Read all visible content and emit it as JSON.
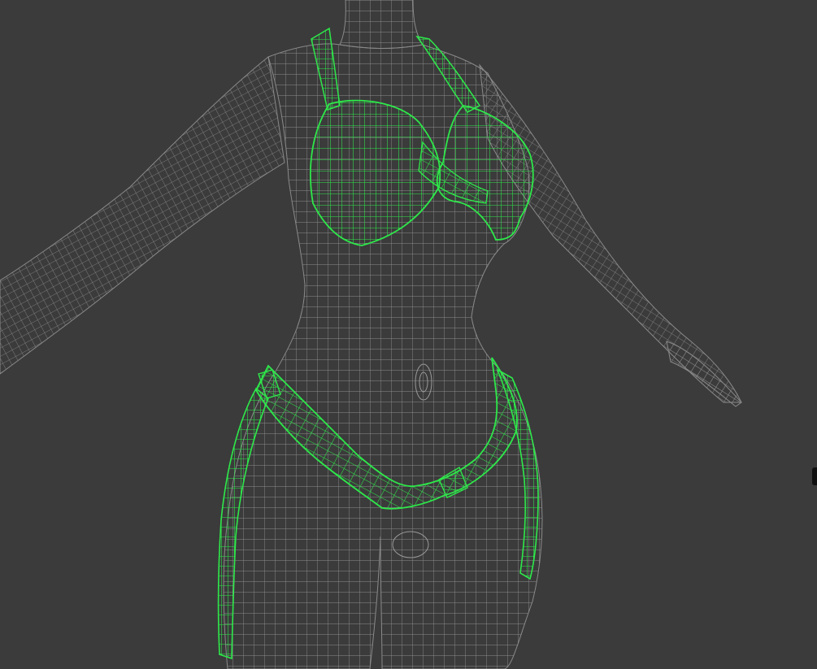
{
  "viewport": {
    "background_color": "#3b3b3b",
    "mesh_color": "#8a8a8a",
    "selection_color": "#2ee84a",
    "mode": "wireframe"
  },
  "scene": {
    "objects": [
      {
        "name": "body",
        "selected": false
      },
      {
        "name": "bikini-top",
        "selected": true
      },
      {
        "name": "bikini-bottom",
        "selected": true
      }
    ]
  }
}
